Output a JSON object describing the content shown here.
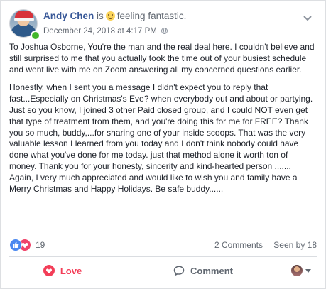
{
  "post": {
    "author": "Andy Chen",
    "is_word": "is",
    "feeling_text": "feeling fantastic.",
    "feeling_icon": "grinning-face-icon",
    "timestamp": "December 24, 2018 at 4:17 PM",
    "privacy_icon": "globe-icon",
    "paragraphs": [
      "To Joshua Osborne, You're the man and the real deal here. I couldn't believe and still surprised to me that you actually took the time out of your busiest schedule and went live with me on Zoom answering all my concerned questions earlier.",
      "Honestly, when I sent you a message I didn't expect you to reply that fast...Especially on Christmas's Eve? when everybody out and about or partying. Just so you know, I joined 3 other Paid closed group, and I could NOT even get that type of treatment from them, and you're doing this for me for FREE? Thank you so much, buddy,...for sharing one of your inside scoops. That was the very valuable lesson I learned from you today and I don't think nobody could have done what you've done for me today. just that method alone it worth ton of money. Thank you for your honesty, sincerity and kind-hearted person .......\nAgain, I very much appreciated and would like to wish you and family have a Merry Christmas and Happy Holidays. Be safe buddy......"
    ]
  },
  "reactions": {
    "count": "19",
    "icons": [
      "like-icon",
      "love-icon"
    ],
    "comments": "2 Comments",
    "seen": "Seen by 18"
  },
  "actions": {
    "love_label": "Love",
    "comment_label": "Comment"
  },
  "colors": {
    "name_blue": "#385898",
    "love_red": "#f33e58",
    "like_blue": "#4a88f0",
    "online_green": "#42b72a"
  }
}
